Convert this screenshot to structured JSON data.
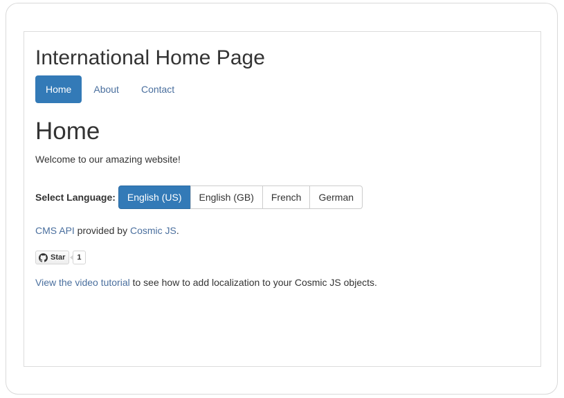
{
  "site": {
    "title": "International Home Page"
  },
  "nav": {
    "items": [
      {
        "label": "Home",
        "active": true
      },
      {
        "label": "About",
        "active": false
      },
      {
        "label": "Contact",
        "active": false
      }
    ]
  },
  "main": {
    "heading": "Home",
    "welcome": "Welcome to our amazing website!"
  },
  "language": {
    "label": "Select Language:",
    "options": [
      {
        "label": "English (US)",
        "active": true
      },
      {
        "label": "English (GB)",
        "active": false
      },
      {
        "label": "French",
        "active": false
      },
      {
        "label": "German",
        "active": false
      }
    ]
  },
  "credits": {
    "api_link": "CMS API",
    "provided_by": " provided by ",
    "provider_link": "Cosmic JS",
    "end": "."
  },
  "github": {
    "icon": "github-icon",
    "star_label": "Star",
    "star_count": "1"
  },
  "video": {
    "link": "View the video tutorial",
    "rest": " to see how to add localization to your Cosmic JS objects."
  },
  "colors": {
    "accent": "#337ab7",
    "link": "#4a6f9e",
    "text": "#333333"
  }
}
